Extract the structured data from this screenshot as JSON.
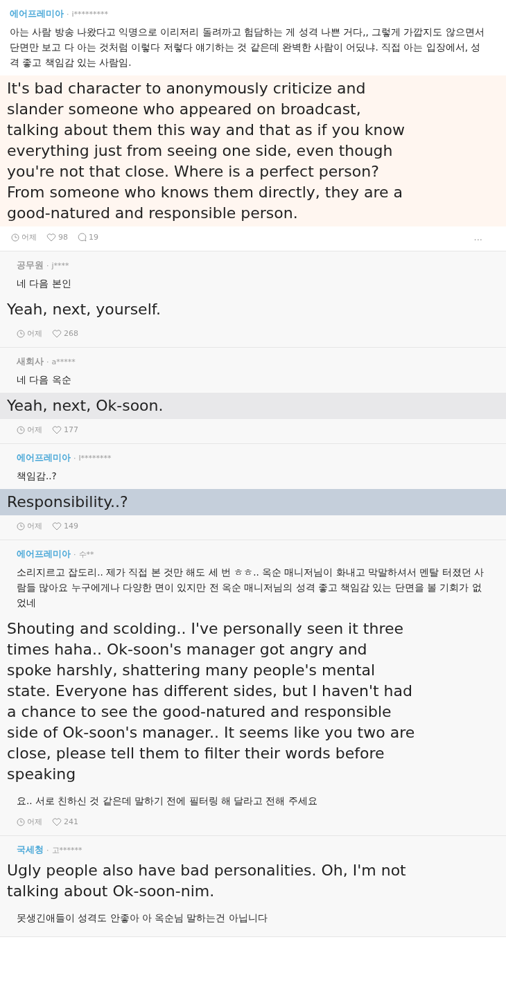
{
  "comments": [
    {
      "group": "에어프레미아",
      "color": "#4aa8d8",
      "sep": "·",
      "user": "i*********",
      "highlighted": true,
      "blocks": [
        {
          "kind": "original",
          "text": "아는 사람 방송 나왔다고 익명으로 이리저리 돌려까고 험담하는 게 성격 나쁜 거다,, 그렇게 가깝지도 않으면서 단면만 보고 다 아는 것처럼 이렇다 저렇다 얘기하는 것 같은데 완벽한 사람이 어딨냐. 직접 아는 입장에서, 성격 좋고 책임감 있는 사람임."
        },
        {
          "kind": "translation",
          "color": "#fff6f0",
          "text": "It's bad character to anonymously criticize and slander someone who appeared on broadcast, talking about them this way and that as if you know everything just from seeing one side, even though you're not that close. Where is a perfect person? From someone who knows them directly, they are a good-natured and responsible person."
        }
      ],
      "time": "어제",
      "likes": "98",
      "replies": "19",
      "more": "..."
    },
    {
      "group": "공무원",
      "color": "#999999",
      "sep": "·",
      "user": "j****",
      "highlighted": false,
      "blocks": [
        {
          "kind": "original",
          "text": "네 다음 본인"
        },
        {
          "kind": "translation",
          "color": "#f8f8f8",
          "text": "Yeah, next, yourself."
        }
      ],
      "time": "어제",
      "likes": "268"
    },
    {
      "group": "새회사",
      "color": "#999999",
      "sep": "·",
      "user": "a*****",
      "highlighted": false,
      "blocks": [
        {
          "kind": "original",
          "text": "네 다음 옥순"
        },
        {
          "kind": "translation",
          "color": "#e8e8ea",
          "text": "Yeah, next, Ok-soon."
        }
      ],
      "time": "어제",
      "likes": "177"
    },
    {
      "group": "에어프레미아",
      "color": "#4aa8d8",
      "sep": "·",
      "user": "l********",
      "highlighted": false,
      "blocks": [
        {
          "kind": "original",
          "text": "책임감..?"
        },
        {
          "kind": "translation",
          "color": "#c5cfdb",
          "text": "Responsibility..?"
        }
      ],
      "time": "어제",
      "likes": "149"
    },
    {
      "group": "에어프레미아",
      "color": "#4aa8d8",
      "sep": "·",
      "user": "수**",
      "highlighted": false,
      "blocks": [
        {
          "kind": "original",
          "text": "소리지르고 잡도리.. 제가 직접 본 것만 해도 세 번 ㅎㅎ.. 옥순 매니저님이 화내고 막말하셔서 멘탈 터졌던 사람들 많아요 누구에게나 다양한 면이 있지만 전 옥순 매니저님의 성격 좋고 책임감 있는 단면을 볼 기회가 없었네"
        },
        {
          "kind": "translation",
          "color": "#f8f8f8",
          "text": "Shouting and scolding.. I've personally seen it three times haha.. Ok-soon's manager got angry and spoke harshly, shattering many people's mental state. Everyone has different sides, but I haven't had a chance to see the good-natured and responsible side of Ok-soon's manager.. It seems like you two are close, please tell them to filter their words before speaking"
        },
        {
          "kind": "original",
          "text": "요.. 서로 친하신 것 같은데 말하기 전에 필터링 해 달라고 전해 주세요"
        }
      ],
      "time": "어제",
      "likes": "241"
    },
    {
      "group": "국세청",
      "color": "#4aa8d8",
      "sep": "·",
      "user": "고******",
      "highlighted": false,
      "blocks": [
        {
          "kind": "translation",
          "color": "#f8f8f8",
          "text": "Ugly people also have bad personalities. Oh, I'm not talking about Ok-soon-nim."
        },
        {
          "kind": "original",
          "text": "못생긴애들이 성격도 안좋아 아 옥순님 말하는건 아닙니다"
        }
      ]
    }
  ]
}
